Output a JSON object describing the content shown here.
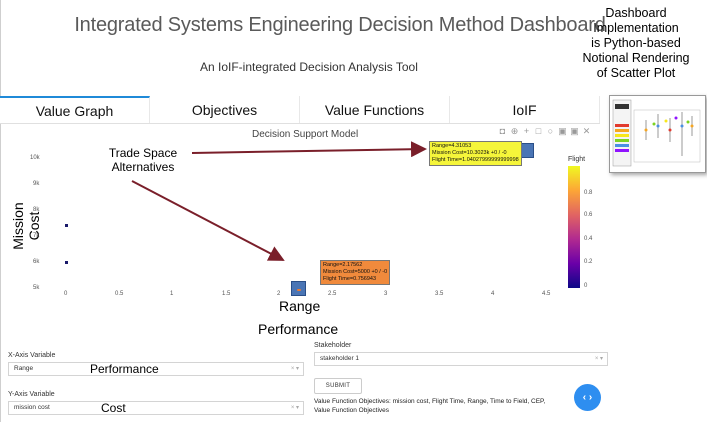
{
  "app": {
    "title": "Integrated Systems Engineering Decision Method Dashboard",
    "subtitle": "An IoIF-integrated Decision Analysis Tool"
  },
  "top_right_annotation": {
    "line1": "Dashboard",
    "line2": "Implementation",
    "line3": "is Python-based",
    "line4": "Notional Rendering",
    "line5": "of Scatter Plot"
  },
  "tabs": [
    {
      "label": "Value Graph",
      "active": true
    },
    {
      "label": "Objectives",
      "active": false
    },
    {
      "label": "Value Functions",
      "active": false
    },
    {
      "label": "IoIF",
      "active": false
    }
  ],
  "chart": {
    "title": "Decision Support Model",
    "toolbar_icons": [
      "camera-icon",
      "zoom-icon",
      "pan-icon",
      "box-select-icon",
      "lasso-icon",
      "zoom-in-icon",
      "zoom-out-icon",
      "close-icon"
    ],
    "toolbar_glyphs": [
      "◘",
      "⊕",
      "+",
      "□",
      "○",
      "▣",
      "▣",
      "✕"
    ],
    "y_title": "Mission Cost",
    "y_ticks": [
      "10k",
      "9k",
      "8k",
      "7k",
      "6k",
      "5k"
    ],
    "x_ticks": [
      "0",
      "0.5",
      "1",
      "1.5",
      "2",
      "2.5",
      "3",
      "3.5",
      "4",
      "4.5"
    ],
    "x_title_line1": "Range",
    "x_title_line2": "Performance",
    "colorbar_title": "Flight",
    "colorbar_ticks": [
      "0.8",
      "0.6",
      "0.4",
      "0.2",
      "0"
    ],
    "tooltip_1": {
      "line1": "Range=4.31053",
      "line2": "Mission Cost=10.3023k +0 / -0",
      "line3": "Flight Time=1.04027999999999998"
    },
    "tooltip_2": {
      "line1": "Range=2.17562",
      "line2": "Mission Cost=5000 +0 / -0",
      "line3": "Flight Time=0.756943"
    }
  },
  "chart_data": {
    "type": "scatter",
    "title": "Decision Support Model",
    "xlabel": "Range",
    "ylabel": "Mission Cost",
    "xlim": [
      -0.1,
      4.8
    ],
    "ylim": [
      4800,
      10300
    ],
    "points": [
      {
        "x": 0,
        "y": 7400
      },
      {
        "x": 0,
        "y": 6000
      },
      {
        "x": 4.31053,
        "y": 10302.3,
        "flight_time": 1.04028
      },
      {
        "x": 2.17562,
        "y": 5000,
        "flight_time": 0.756943
      }
    ],
    "colorbar": {
      "label": "Flight",
      "range": [
        0,
        1
      ]
    },
    "grid": false
  },
  "annotations": {
    "trade_space_line1": "Trade Space",
    "trade_space_line2": "Alternatives"
  },
  "controls": {
    "x_axis_label": "X-Axis Variable",
    "x_axis_value": "Range",
    "x_axis_overlay": "Performance",
    "y_axis_label": "Y-Axis Variable",
    "y_axis_value": "mission cost",
    "y_axis_overlay": "Cost",
    "stakeholder_label": "Stakeholder",
    "stakeholder_value": "stakeholder 1",
    "clear_glyph": "× ▾",
    "submit_label": "SUBMIT",
    "vf_line1": "Value Function Objectives: mission cost, Flight Time, Range, Time to Field, CEP,",
    "vf_line2": "Value Function Objectives",
    "round_button_glyph": "‹ ›"
  },
  "colors": {
    "accent": "#2e8ef0",
    "marker": "#4a75b5",
    "arrow": "#7a1f2a",
    "tooltip_yellow": "#f5f53a",
    "tooltip_orange": "#f08a3c"
  }
}
